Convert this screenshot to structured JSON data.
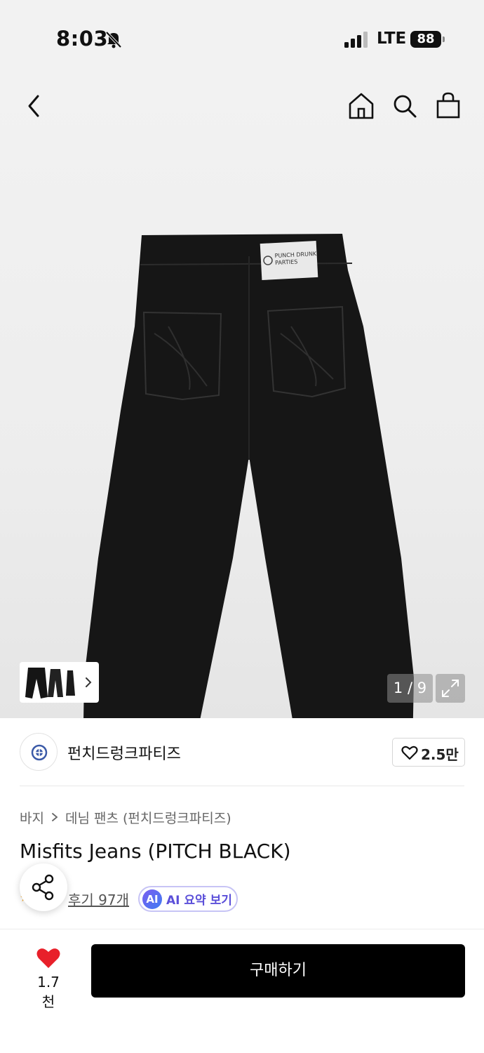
{
  "status_bar": {
    "time": "8:03",
    "network": "LTE",
    "battery": "88",
    "icons": [
      "bell-off-icon",
      "signal-icon",
      "battery-icon"
    ]
  },
  "nav": {
    "icons": [
      "back-icon",
      "home-icon",
      "search-icon",
      "shopping-bag-icon"
    ]
  },
  "gallery": {
    "counter": "1 / 9",
    "label_lines": [
      "PUNCH DRUNK",
      "PARTIES"
    ],
    "current_index": 1,
    "total": 9
  },
  "brand": {
    "name": "펀치드렁크파티즈",
    "like_count": "2.5만"
  },
  "breadcrumb": {
    "items": [
      "바지",
      "데님 팬츠 (펀치드렁크파티즈)"
    ]
  },
  "product": {
    "title": "Misfits Jeans (PITCH BLACK)",
    "review_link": "후기 97개",
    "ai_badge": "AI",
    "ai_summary_label": "AI 요약 보기"
  },
  "bottom_bar": {
    "wish_count": "1.7천",
    "buy_label": "구매하기"
  },
  "colors": {
    "accent_purple": "#5b4fd9",
    "heart_red": "#e8202a",
    "buy_button": "#000000"
  }
}
